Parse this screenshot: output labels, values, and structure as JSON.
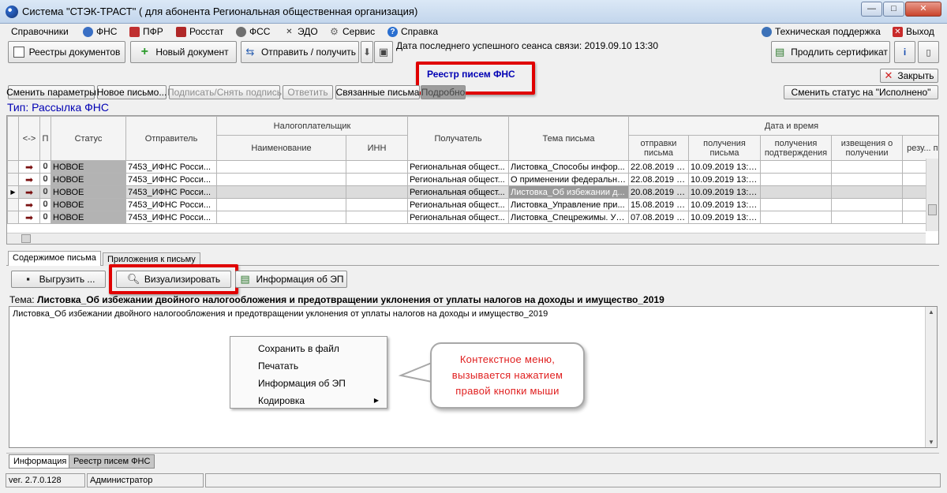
{
  "window": {
    "title": "Система \"СТЭК-ТРАСТ\" ( для абонента Региональная общественная организация)",
    "controls": {
      "minimize": "—",
      "maximize": "□",
      "close": "✕"
    }
  },
  "menu": {
    "items": [
      {
        "label": "Справочники"
      },
      {
        "label": "ФНС",
        "icon": "fns-icon"
      },
      {
        "label": "ПФР",
        "icon": "pfr-icon"
      },
      {
        "label": "Росстат",
        "icon": "rosstat-icon"
      },
      {
        "label": "ФСС",
        "icon": "fss-icon"
      },
      {
        "label": "ЭДО",
        "icon": "edo-icon"
      },
      {
        "label": "Сервис",
        "icon": "gear-icon"
      },
      {
        "label": "Справка",
        "icon": "help-icon"
      }
    ],
    "right": [
      {
        "label": "Техническая поддержка",
        "icon": "support-icon"
      },
      {
        "label": "Выход",
        "icon": "exit-icon"
      }
    ]
  },
  "toolbar": {
    "registries": "Реестры документов",
    "new_doc": "Новый документ",
    "send_receive": "Отправить / получить",
    "last_session": "Дата последнего успешного сеанса связи: 2019.09.10 13:30",
    "extend_cert": "Продлить сертификат"
  },
  "panel": {
    "title": "Реестр писем ФНС",
    "close": "Закрыть",
    "type_label": "Тип: Рассылка ФНС"
  },
  "actions": {
    "change_params": "Сменить параметры",
    "new_letter": "Новое письмо...",
    "sign": "Подписать/Снять подпись",
    "reply": "Ответить",
    "linked": "Связанные письма",
    "more": "Подробно",
    "set_status": "Сменить статус на \"Исполнено\""
  },
  "table": {
    "headers": {
      "arrows": "<->",
      "p": "П",
      "status": "Статус",
      "sender": "Отправитель",
      "taxpayer": "Налогоплательщик",
      "name": "Наименование",
      "inn": "ИНН",
      "recipient": "Получатель",
      "subject": "Тема письма",
      "datetime": "Дата и время",
      "sent": "отправки письма",
      "received": "получения письма",
      "confirm": "получения подтверждения",
      "notice": "извещения о получении",
      "result": "резу... пр..."
    },
    "rows": [
      {
        "status": "НОВОЕ",
        "sender": "7453_ИФНС Росси...",
        "name": "",
        "inn": "",
        "recipient": "Региональная общест...",
        "subject": "Листовка_Способы инфор...",
        "sent": "22.08.2019 1...",
        "received": "10.09.2019 13:3...",
        "confirm": "",
        "notice": "",
        "selected": false
      },
      {
        "status": "НОВОЕ",
        "sender": "7453_ИФНС Росси...",
        "name": "",
        "inn": "",
        "recipient": "Региональная общест...",
        "subject": "О применении федерально...",
        "sent": "22.08.2019 1...",
        "received": "10.09.2019 13:3...",
        "confirm": "",
        "notice": "",
        "selected": false
      },
      {
        "status": "НОВОЕ",
        "sender": "7453_ИФНС Росси...",
        "name": "",
        "inn": "",
        "recipient": "Региональная общест...",
        "subject": "Листовка_Об избежании д...",
        "sent": "20.08.2019 1...",
        "received": "10.09.2019 13:3...",
        "confirm": "",
        "notice": "",
        "selected": true
      },
      {
        "status": "НОВОЕ",
        "sender": "7453_ИФНС Росси...",
        "name": "",
        "inn": "",
        "recipient": "Региональная общест...",
        "subject": "Листовка_Управление при...",
        "sent": "15.08.2019 1...",
        "received": "10.09.2019 13:3...",
        "confirm": "",
        "notice": "",
        "selected": false
      },
      {
        "status": "НОВОЕ",
        "sender": "7453_ИФНС Росси...",
        "name": "",
        "inn": "",
        "recipient": "Региональная общест...",
        "subject": "Листовка_Спецрежимы. Уч...",
        "sent": "07.08.2019 1...",
        "received": "10.09.2019 13:3...",
        "confirm": "",
        "notice": "",
        "selected": false
      }
    ]
  },
  "tabs": {
    "content": "Содержимое письма",
    "attachments": "Приложения к письму"
  },
  "content": {
    "export": "Выгрузить ...",
    "visualize": "Визуализировать",
    "sig_info": "Информация об ЭП",
    "subject_label": "Тема:",
    "subject_value": "Листовка_Об избежании двойного налогообложения и предотвращении уклонения от уплаты налогов на доходы и имущество_2019",
    "body": "Листовка_Об избежании двойного налогообложения и предотвращении уклонения от уплаты налогов на доходы и имущество_2019"
  },
  "context_menu": {
    "items": [
      "Сохранить в файл",
      "Печатать",
      "Информация об ЭП",
      "Кодировка"
    ]
  },
  "callout": {
    "line1": "Контекстное меню,",
    "line2": "вызывается нажатием",
    "line3": "правой кнопки мыши"
  },
  "bottom_tabs": [
    "Информация",
    "Реестр писем ФНС"
  ],
  "statusbar": {
    "version": "ver. 2.7.0.128",
    "user": "Администратор"
  },
  "colors": {
    "highlight_red": "#e00000",
    "panel_title_blue": "#0000b4",
    "callout_text": "#e02020"
  }
}
